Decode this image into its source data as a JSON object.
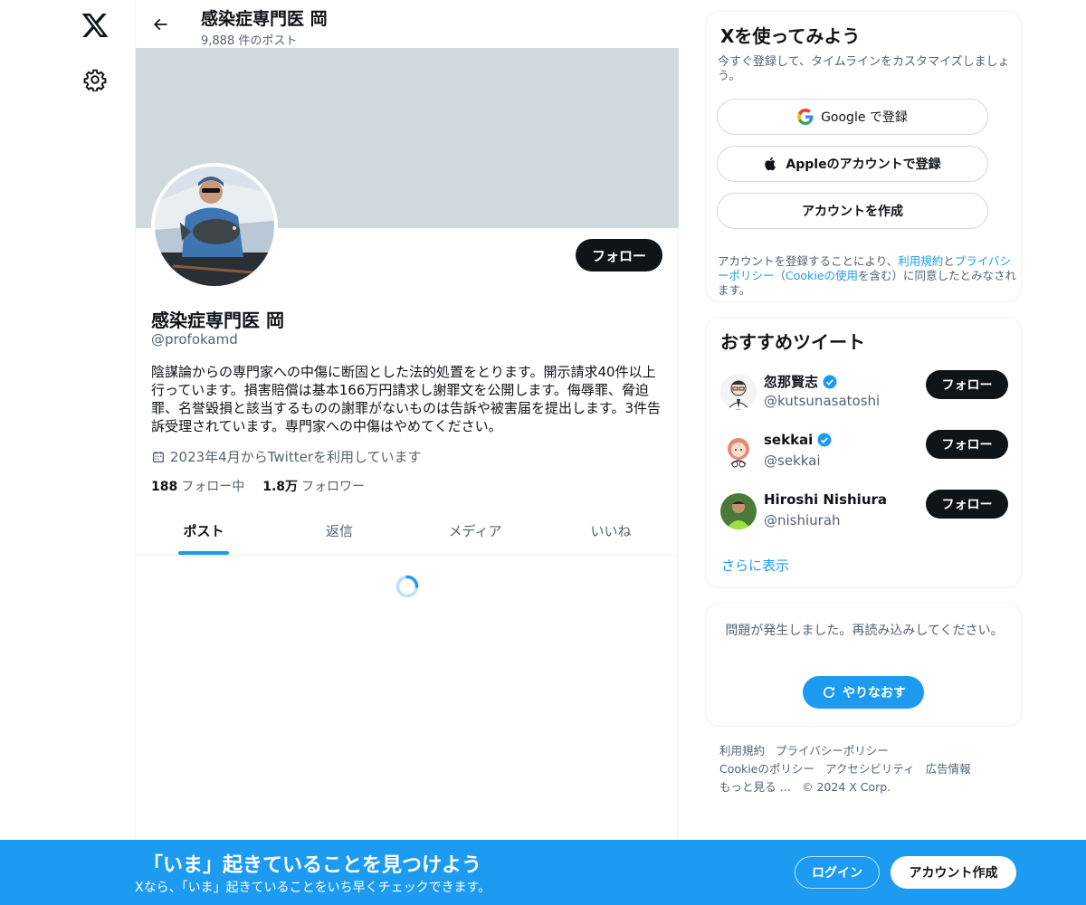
{
  "header": {
    "title": "感染症専門医 岡",
    "post_count": "9,888 件のポスト"
  },
  "profile": {
    "name": "感染症専門医 岡",
    "handle": "@profokamd",
    "bio": "陰謀論からの専門家への中傷に断固とした法的処置をとります。開示請求40件以上行っています。損害賠償は基本166万円請求し謝罪文を公開します。侮辱罪、脅迫罪、名誉毀損と該当するものの謝罪がないものは告訴や被害届を提出します。3件告訴受理されています。専門家への中傷はやめてください。",
    "joined": "2023年4月からTwitterを利用しています",
    "following_count": "188",
    "following_label": "フォロー中",
    "followers_count": "1.8万",
    "followers_label": "フォロワー",
    "follow_button": "フォロー"
  },
  "tabs": [
    {
      "label": "ポスト",
      "active": true
    },
    {
      "label": "返信",
      "active": false
    },
    {
      "label": "メディア",
      "active": false
    },
    {
      "label": "いいね",
      "active": false
    }
  ],
  "signup_card": {
    "title": "Xを使ってみよう",
    "subtitle": "今すぐ登録して、タイムラインをカスタマイズしましょう。",
    "google_label": "Google で登録",
    "apple_label": "Appleのアカウントで登録",
    "create_label": "アカウントを作成",
    "terms_1": "アカウントを登録することにより、",
    "terms_link_1": "利用規約",
    "terms_2": "と",
    "terms_link_2": "プライバシーポリシー",
    "terms_3": "（",
    "terms_link_3": "Cookieの使用",
    "terms_4": "を含む）に同意したとみなされます。"
  },
  "suggestions": {
    "title": "おすすめツイート",
    "items": [
      {
        "name": "忽那賢志",
        "handle": "@kutsunasatoshi",
        "verified": true,
        "button": "フォロー"
      },
      {
        "name": "sekkai",
        "handle": "@sekkai",
        "verified": true,
        "button": "フォロー"
      },
      {
        "name": "Hiroshi Nishiura",
        "handle": "@nishiurah",
        "verified": false,
        "button": "フォロー"
      }
    ],
    "show_more": "さらに表示"
  },
  "error_card": {
    "message": "問題が発生しました。再読み込みしてください。",
    "retry": "やりなおす"
  },
  "footer": {
    "links": [
      "利用規約",
      "プライバシーポリシー",
      "Cookieのポリシー",
      "アクセシビリティ",
      "広告情報",
      "もっと見る …",
      "© 2024 X Corp."
    ]
  },
  "bottom_bar": {
    "title": "「いま」起きていることを見つけよう",
    "subtitle": "Xなら、「いま」起きていることをいち早くチェックできます。",
    "login": "ログイン",
    "signup": "アカウント作成"
  },
  "colors": {
    "accent": "#1d9bf0",
    "text": "#0f1419",
    "secondary": "#536471",
    "banner": "#cfd9de"
  }
}
